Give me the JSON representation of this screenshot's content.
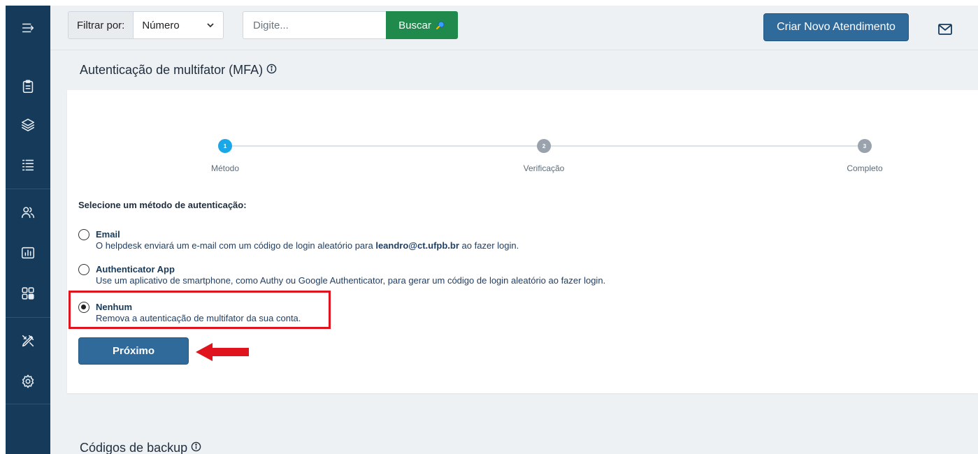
{
  "topbar": {
    "filter_label": "Filtrar por:",
    "filter_value": "Número",
    "search_placeholder": "Digite...",
    "search_button": "Buscar",
    "new_button": "Criar Novo Atendimento"
  },
  "sidebar": {
    "items": [
      {
        "icon": "menu-toggle-icon"
      },
      {
        "icon": "clipboard-icon"
      },
      {
        "icon": "layers-icon"
      },
      {
        "icon": "list-icon"
      },
      {
        "icon": "users-icon"
      },
      {
        "icon": "chart-icon"
      },
      {
        "icon": "grid-icon"
      },
      {
        "icon": "tools-icon"
      },
      {
        "icon": "gear-icon"
      }
    ]
  },
  "mfa": {
    "title": "Autenticação de multifator (MFA)",
    "steps": [
      {
        "number": "1",
        "label": "Método"
      },
      {
        "number": "2",
        "label": "Verificação"
      },
      {
        "number": "3",
        "label": "Completo"
      }
    ],
    "prompt": "Selecione um método de autenticação:",
    "options": [
      {
        "title": "Email",
        "desc_before": "O helpdesk enviará um e-mail com um código de login aleatório para",
        "desc_email": "leandro@ct.ufpb.br",
        "desc_after": "ao fazer login.",
        "checked": false
      },
      {
        "title": "Authenticator App",
        "desc": "Use um aplicativo de smartphone, como Authy ou Google Authenticator, para gerar um código de login aleatório ao fazer login.",
        "checked": false
      },
      {
        "title": "Nenhum",
        "desc": "Remova a autenticação de multifator da sua conta.",
        "checked": true
      }
    ],
    "next_button": "Próximo"
  },
  "backup": {
    "title": "Códigos de backup"
  },
  "colors": {
    "sidebar": "#163a5a",
    "primary": "#2f6a9a",
    "success": "#1f8a4c",
    "step_active": "#1aa7e8",
    "step_inactive": "#9aa3ad",
    "highlight": "#e0141e"
  }
}
